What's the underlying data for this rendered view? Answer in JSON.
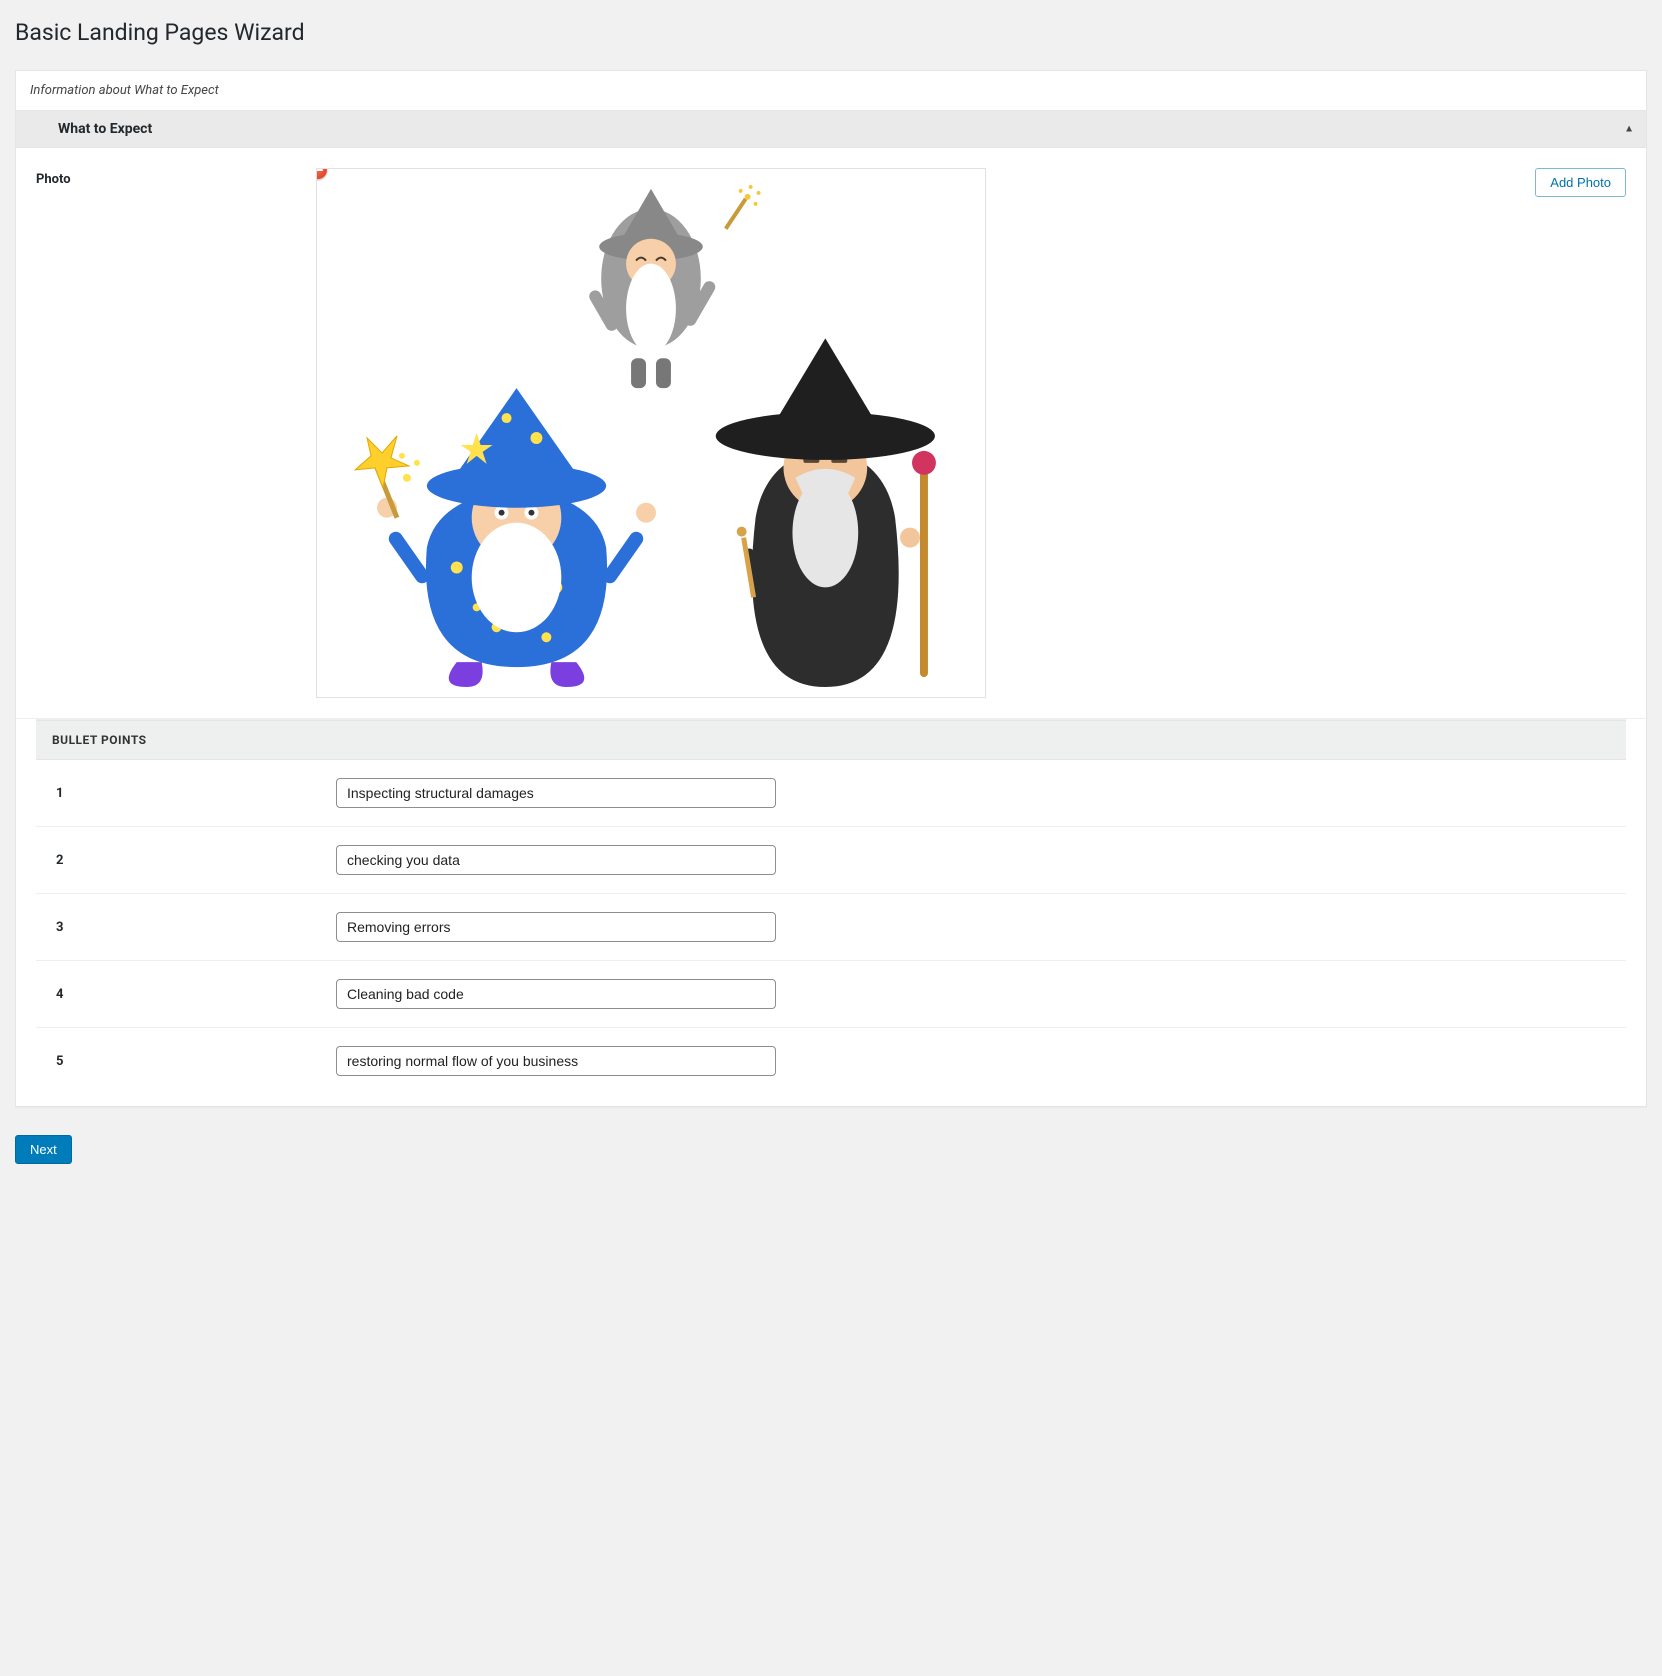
{
  "page": {
    "title": "Basic Landing Pages Wizard",
    "description": "Information about What to Expect"
  },
  "section": {
    "title": "What to Expect",
    "photo_label": "Photo",
    "add_photo_label": "Add Photo",
    "bullet_section_label": "BULLET POINTS",
    "bullets": [
      {
        "label": "1",
        "value": "Inspecting structural damages"
      },
      {
        "label": "2",
        "value": "checking you data"
      },
      {
        "label": "3",
        "value": "Removing errors"
      },
      {
        "label": "4",
        "value": "Cleaning bad code"
      },
      {
        "label": "5",
        "value": "restoring normal flow of you business"
      }
    ]
  },
  "actions": {
    "next_label": "Next"
  }
}
